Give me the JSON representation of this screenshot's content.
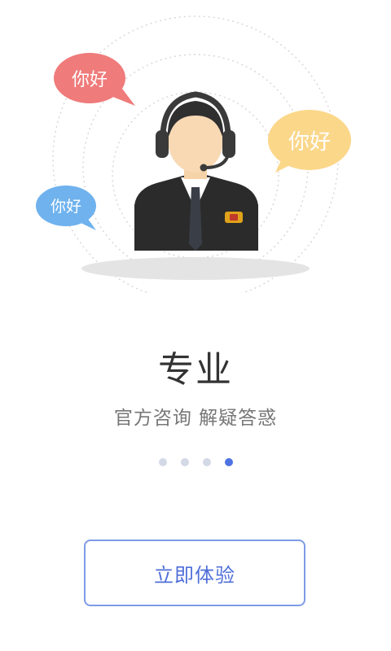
{
  "illustration": {
    "bubbles": [
      {
        "text": "你好",
        "color": "#ef7b7b"
      },
      {
        "text": "你好",
        "color": "#fbd78a"
      },
      {
        "text": "你好",
        "color": "#6fb2ee"
      }
    ]
  },
  "slide": {
    "title": "专业",
    "subtitle": "官方咨询 解疑答惑"
  },
  "pagination": {
    "total": 4,
    "active_index": 3
  },
  "cta": {
    "label": "立即体验"
  },
  "colors": {
    "accent": "#4f73e2",
    "dot_inactive": "#d3d9e6",
    "button_border": "#7e9be6"
  }
}
